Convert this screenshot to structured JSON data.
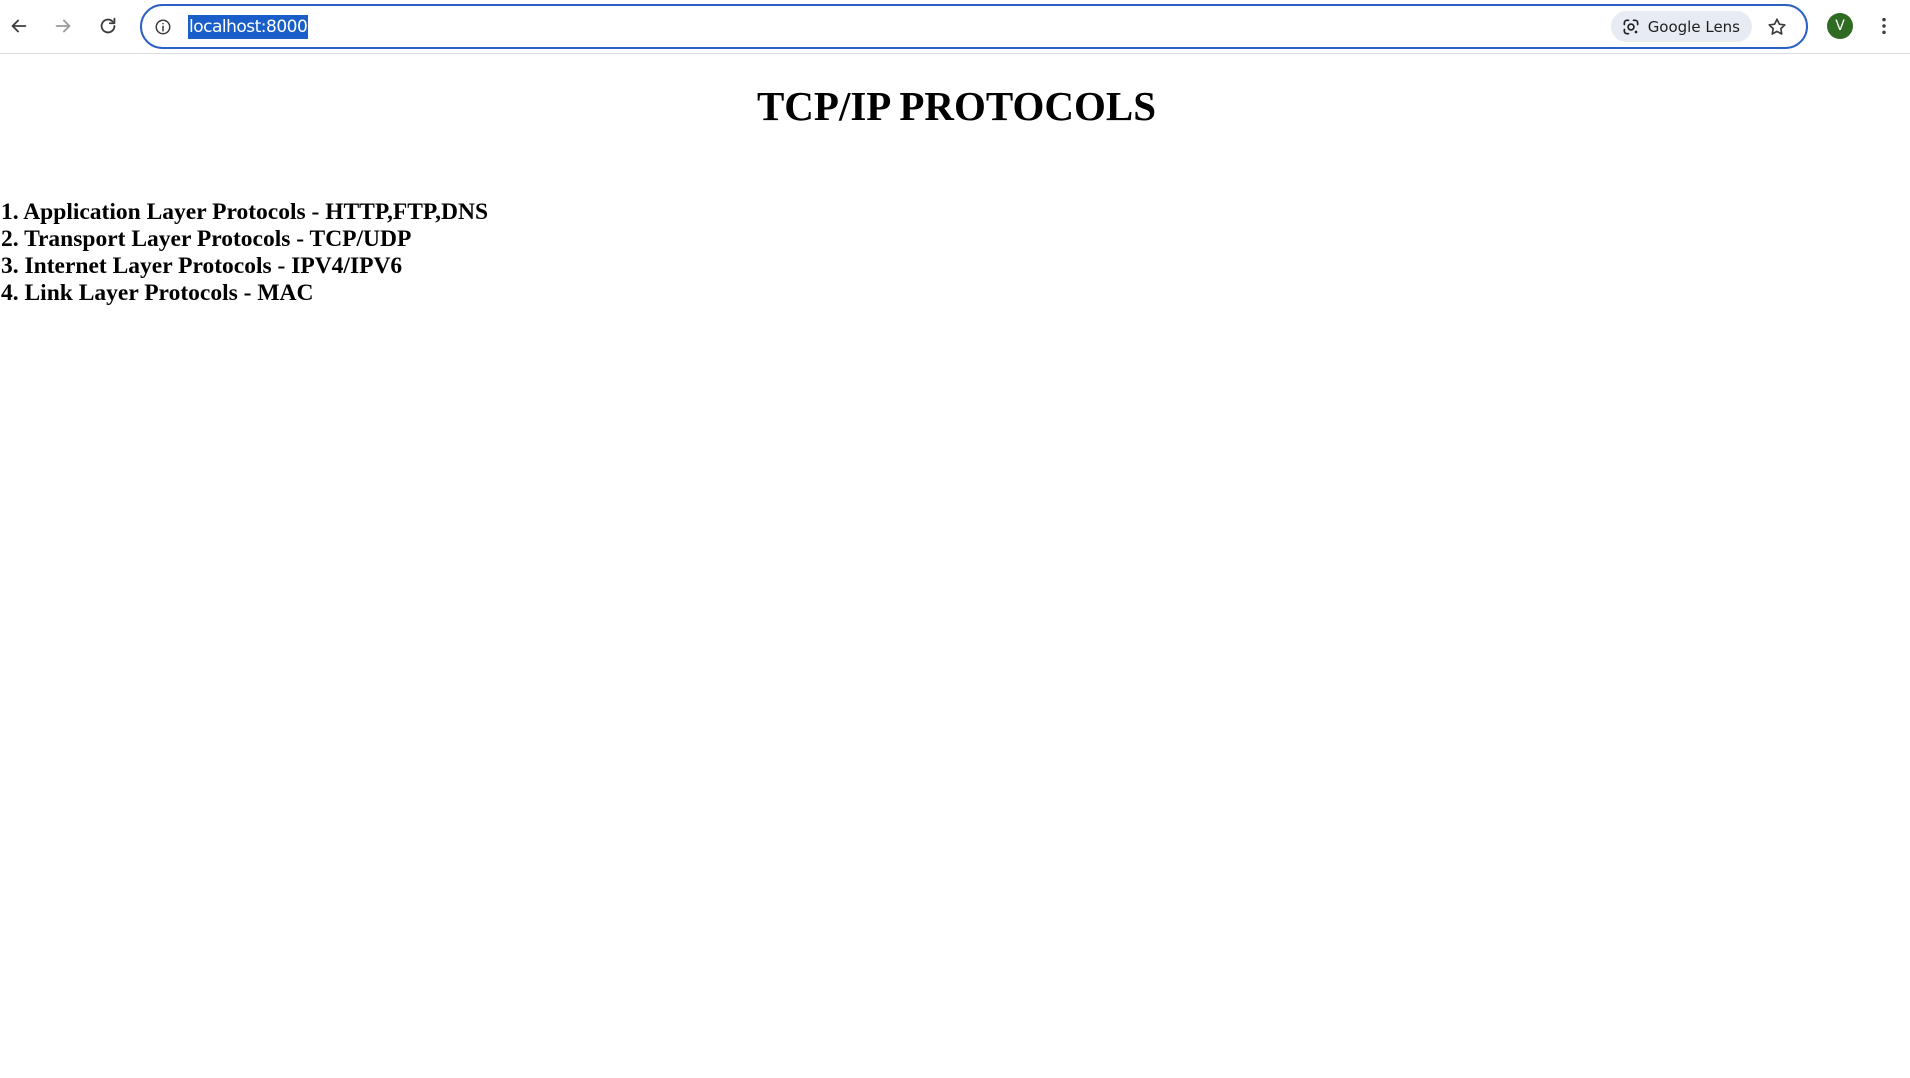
{
  "browser": {
    "url": "localhost:8000",
    "lens_label": "Google Lens",
    "profile_initial": "V",
    "profile_color": "#2f6b22",
    "accent_color": "#2a5fc4",
    "icons": {
      "back": "arrow-left-icon",
      "forward": "arrow-right-icon",
      "reload": "reload-icon",
      "site_info": "info-icon",
      "lens": "google-lens-icon",
      "bookmark": "star-icon",
      "menu": "kebab-menu-icon"
    }
  },
  "page": {
    "title": "TCP/IP PROTOCOLS",
    "items": [
      "1. Application Layer Protocols - HTTP,FTP,DNS",
      "2. Transport Layer Protocols - TCP/UDP",
      "3. Internet Layer Protocols - IPV4/IPV6",
      "4. Link Layer Protocols - MAC"
    ]
  }
}
